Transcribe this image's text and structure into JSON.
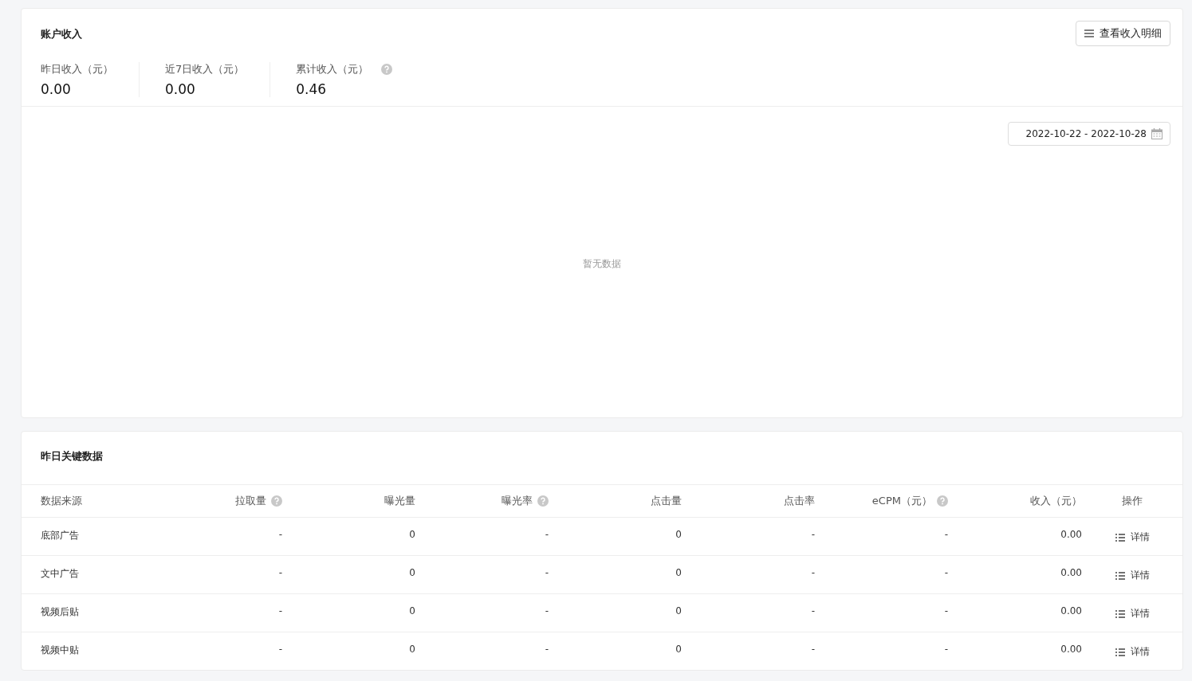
{
  "income_card": {
    "title": "账户收入",
    "detail_button": "查看收入明细",
    "stats": [
      {
        "label": "昨日收入（元）",
        "value": "0.00",
        "help": false
      },
      {
        "label": "近7日收入（元）",
        "value": "0.00",
        "help": false
      },
      {
        "label": "累计收入（元）",
        "value": "0.46",
        "help": true
      }
    ],
    "date_range": "2022-10-22 - 2022-10-28",
    "empty_text": "暂无数据"
  },
  "key_data": {
    "title": "昨日关键数据",
    "columns": [
      {
        "label": "数据来源",
        "help": false
      },
      {
        "label": "拉取量",
        "help": true
      },
      {
        "label": "曝光量",
        "help": false
      },
      {
        "label": "曝光率",
        "help": true
      },
      {
        "label": "点击量",
        "help": false
      },
      {
        "label": "点击率",
        "help": false
      },
      {
        "label": "eCPM（元）",
        "help": true
      },
      {
        "label": "收入（元）",
        "help": false
      },
      {
        "label": "操作",
        "help": false
      }
    ],
    "rows": [
      {
        "cells": [
          "底部广告",
          "-",
          "0",
          "-",
          "0",
          "-",
          "-",
          "0.00"
        ],
        "action": "详情"
      },
      {
        "cells": [
          "文中广告",
          "-",
          "0",
          "-",
          "0",
          "-",
          "-",
          "0.00"
        ],
        "action": "详情"
      },
      {
        "cells": [
          "视频后贴",
          "-",
          "0",
          "-",
          "0",
          "-",
          "-",
          "0.00"
        ],
        "action": "详情"
      },
      {
        "cells": [
          "视频中贴",
          "-",
          "0",
          "-",
          "0",
          "-",
          "-",
          "0.00"
        ],
        "action": "详情"
      }
    ]
  }
}
